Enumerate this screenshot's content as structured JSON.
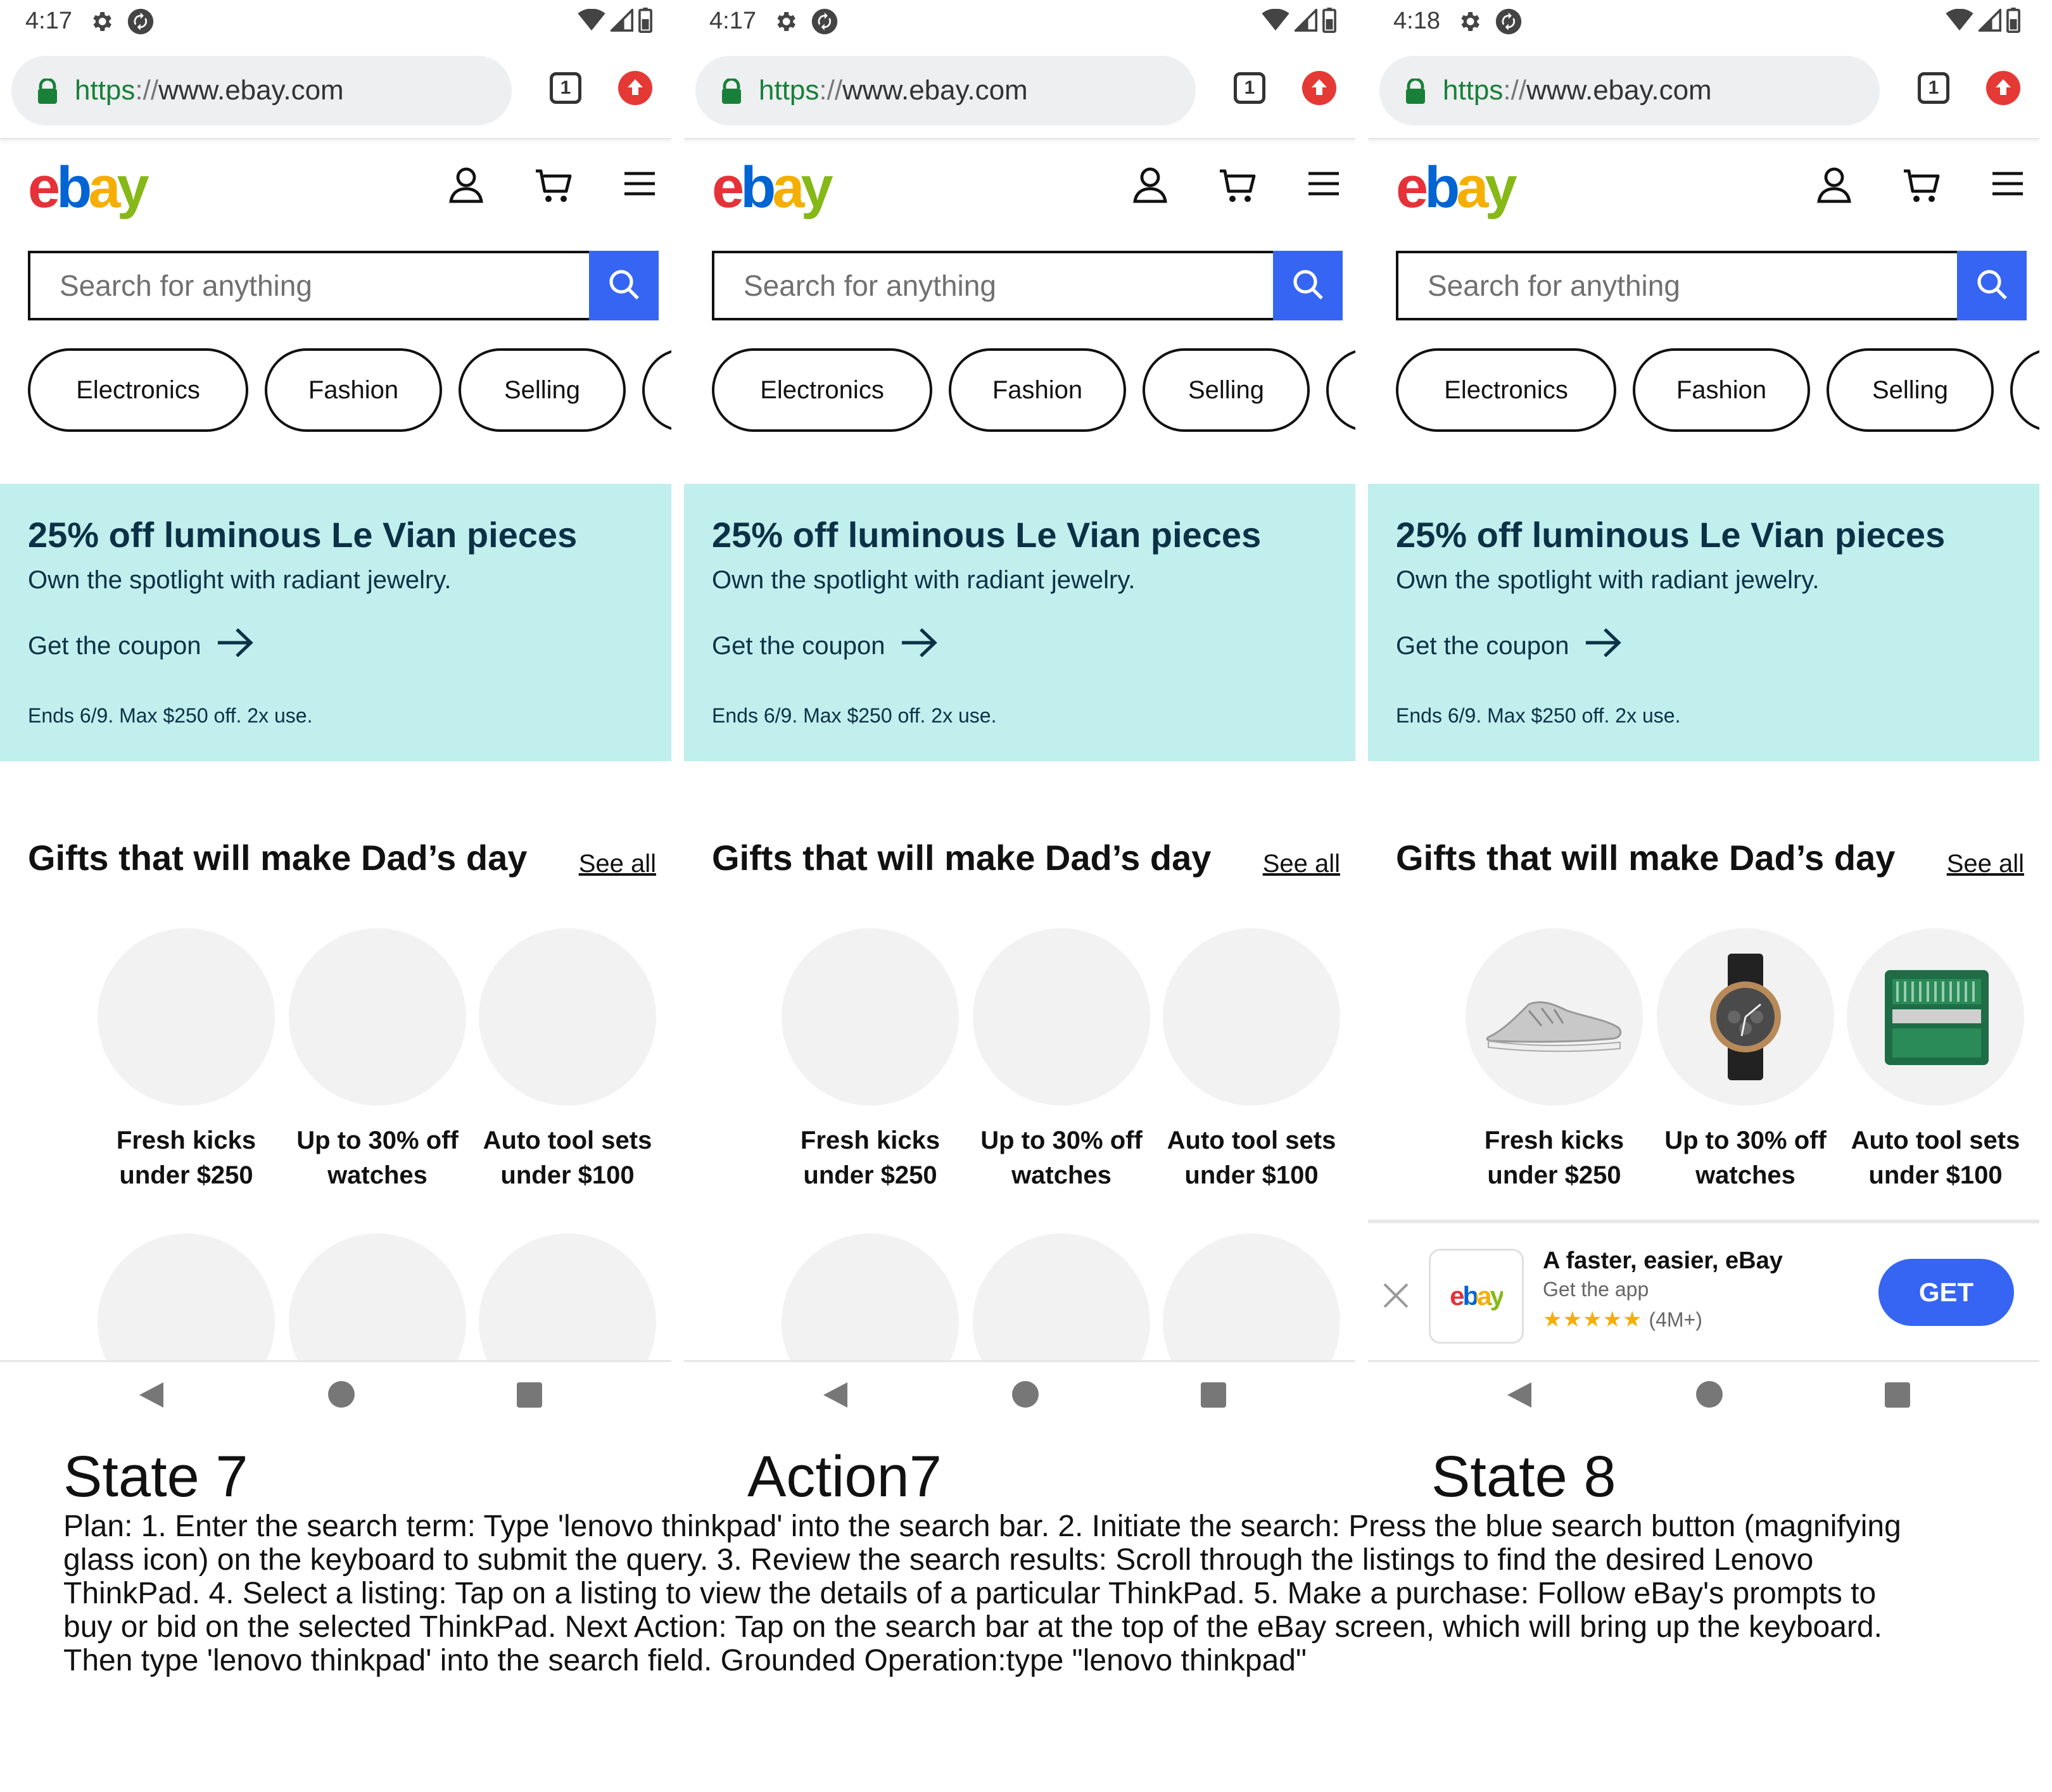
{
  "panels": [
    {
      "status_time": "4:17",
      "url": {
        "scheme": "https",
        "sep": "://",
        "host": "www.ebay.com"
      },
      "tab_count": "1",
      "search_placeholder": "Search for anything",
      "pills": [
        "Electronics",
        "Fashion",
        "Selling"
      ],
      "promo": {
        "title": "25% off luminous Le Vian pieces",
        "subtitle": "Own the spotlight with radiant jewelry.",
        "cta": "Get the coupon",
        "terms": "Ends 6/9. Max $250 off. 2x use."
      },
      "gifts": {
        "title": "Gifts that will make Dad’s day",
        "see_all": "See all",
        "items": [
          {
            "line1": "Fresh kicks",
            "line2": "under $250"
          },
          {
            "line1": "Up to 30% off",
            "line2": "watches"
          },
          {
            "line1": "Auto tool sets",
            "line2": "under $100"
          }
        ]
      }
    },
    {
      "status_time": "4:17",
      "url": {
        "scheme": "https",
        "sep": "://",
        "host": "www.ebay.com"
      },
      "tab_count": "1",
      "search_placeholder": "Search for anything",
      "pills": [
        "Electronics",
        "Fashion",
        "Selling"
      ],
      "promo": {
        "title": "25% off luminous Le Vian pieces",
        "subtitle": "Own the spotlight with radiant jewelry.",
        "cta": "Get the coupon",
        "terms": "Ends 6/9. Max $250 off. 2x use."
      },
      "gifts": {
        "title": "Gifts that will make Dad’s day",
        "see_all": "See all",
        "items": [
          {
            "line1": "Fresh kicks",
            "line2": "under $250"
          },
          {
            "line1": "Up to 30% off",
            "line2": "watches"
          },
          {
            "line1": "Auto tool sets",
            "line2": "under $100"
          }
        ]
      }
    },
    {
      "status_time": "4:18",
      "url": {
        "scheme": "https",
        "sep": "://",
        "host": "www.ebay.com"
      },
      "tab_count": "1",
      "search_placeholder": "Search for anything",
      "pills": [
        "Electronics",
        "Fashion",
        "Selling"
      ],
      "promo": {
        "title": "25% off luminous Le Vian pieces",
        "subtitle": "Own the spotlight with radiant jewelry.",
        "cta": "Get the coupon",
        "terms": "Ends 6/9. Max $250 off. 2x use."
      },
      "gifts": {
        "title": "Gifts that will make Dad’s day",
        "see_all": "See all",
        "items": [
          {
            "line1": "Fresh kicks",
            "line2": "under $250"
          },
          {
            "line1": "Up to 30% off",
            "line2": "watches"
          },
          {
            "line1": "Auto tool sets",
            "line2": "under $100"
          }
        ]
      },
      "app_banner": {
        "title": "A faster, easier, eBay",
        "subtitle": "Get the app",
        "stars": "★★★★★",
        "rating_count": "(4M+)",
        "get_label": "GET",
        "logo_text": "ebay"
      }
    }
  ],
  "logo": {
    "e": "e",
    "b": "b",
    "a": "a",
    "y": "y"
  },
  "labels": {
    "state_7": "State 7",
    "action_7": "Action7",
    "state_8": "State 8"
  },
  "plan_text": "Plan: 1. Enter the search term: Type 'lenovo thinkpad' into the search bar. 2. Initiate the search: Press the blue search button (magnifying glass icon) on the keyboard to submit the query. 3. Review the search results: Scroll through the listings to find the desired Lenovo ThinkPad. 4. Select a listing: Tap on a listing to view the details of a particular ThinkPad. 5. Make a purchase: Follow eBay's prompts to buy or bid on the selected ThinkPad. Next Action: Tap on the search bar at the top of the eBay screen, which will bring up the keyboard. Then type 'lenovo thinkpad' into the search field. Grounded Operation:type \"lenovo thinkpad\"",
  "colors": {
    "accent_blue": "#3665f3",
    "promo_bg": "#c0efed",
    "promo_text": "#0b3146",
    "secure_green": "#188038"
  },
  "icons": [
    "gear-icon",
    "sync-icon",
    "wifi-icon",
    "signal-icon",
    "battery-icon",
    "lock-icon",
    "tab-switcher-icon",
    "update-icon",
    "user-icon",
    "cart-icon",
    "menu-icon",
    "search-icon",
    "arrow-right-icon",
    "close-icon",
    "back-icon",
    "home-icon",
    "recents-icon"
  ]
}
